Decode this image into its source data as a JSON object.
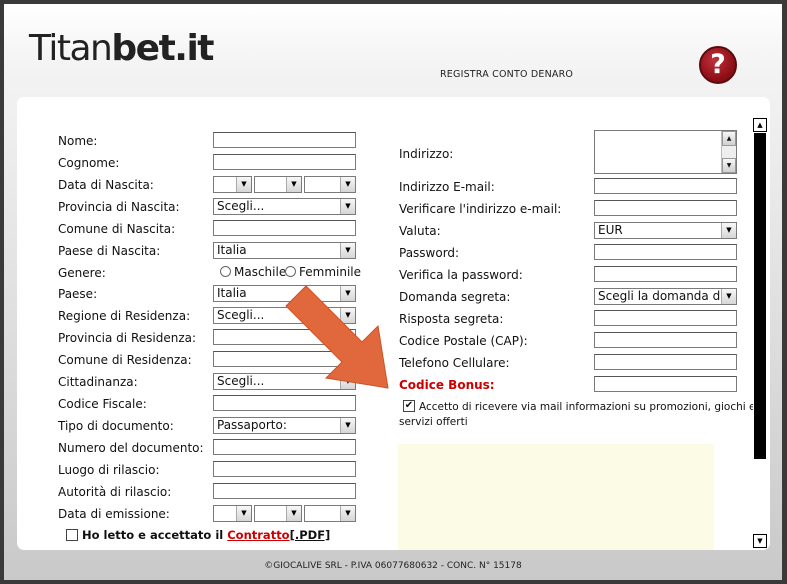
{
  "header": {
    "logo_part1": "Titan",
    "logo_part2": "bet.it",
    "register_title": "REGISTRA CONTO DENARO",
    "help_symbol": "?"
  },
  "form_left": {
    "nome": "Nome:",
    "cognome": "Cognome:",
    "data_nascita": "Data di Nascita:",
    "provincia_nascita": "Provincia di Nascita:",
    "provincia_nascita_value": "Scegli...",
    "comune_nascita": "Comune di Nascita:",
    "paese_nascita": "Paese di Nascita:",
    "paese_nascita_value": "Italia",
    "genere": "Genere:",
    "maschile": "Maschile",
    "femminile": "Femminile",
    "paese": "Paese:",
    "paese_value": "Italia",
    "regione_residenza": "Regione di Residenza:",
    "regione_residenza_value": "Scegli...",
    "provincia_residenza": "Provincia di Residenza:",
    "comune_residenza": "Comune di Residenza:",
    "cittadinanza": "Cittadinanza:",
    "cittadinanza_value": "Scegli...",
    "codice_fiscale": "Codice Fiscale:",
    "tipo_documento": "Tipo di documento:",
    "tipo_documento_value": "Passaporto:",
    "numero_documento": "Numero del documento:",
    "luogo_rilascio": "Luogo di rilascio:",
    "autorita_rilascio": "Autorità di rilascio:",
    "data_emissione": "Data di emissione:",
    "contract_text": "Ho letto e accettato il",
    "contract_link": "Contratto",
    "contract_pdf": "[.PDF]"
  },
  "form_right": {
    "indirizzo": "Indirizzo:",
    "email": "Indirizzo E-mail:",
    "verifica_email": "Verificare l'indirizzo e-mail:",
    "valuta": "Valuta:",
    "valuta_value": "EUR",
    "password": "Password:",
    "verifica_password": "Verifica la password:",
    "domanda_segreta": "Domanda segreta:",
    "domanda_segreta_value": "Scegli la domanda di si",
    "risposta_segreta": "Risposta segreta:",
    "codice_postale": "Codice Postale (CAP):",
    "telefono": "Telefono Cellulare:",
    "codice_bonus": "Codice Bonus:",
    "accept_mail_line1": "Accetto di ricevere via mail informazioni su promozioni, giochi e",
    "accept_mail_line2": "servizi offerti",
    "check_mark": "✔"
  },
  "footer": {
    "text": "©GIOCALIVE SRL - P.IVA 06077680632 - CONC. N° 15178"
  },
  "icons": {
    "dropdown": "▼",
    "scroll_up": "▲",
    "scroll_down": "▼"
  },
  "colors": {
    "bonus_label": "#cc0000",
    "contract_link": "#cc0000",
    "arrow": "#e0683c",
    "help_button": "#9a0f18",
    "info_box": "#fbfbe6"
  }
}
